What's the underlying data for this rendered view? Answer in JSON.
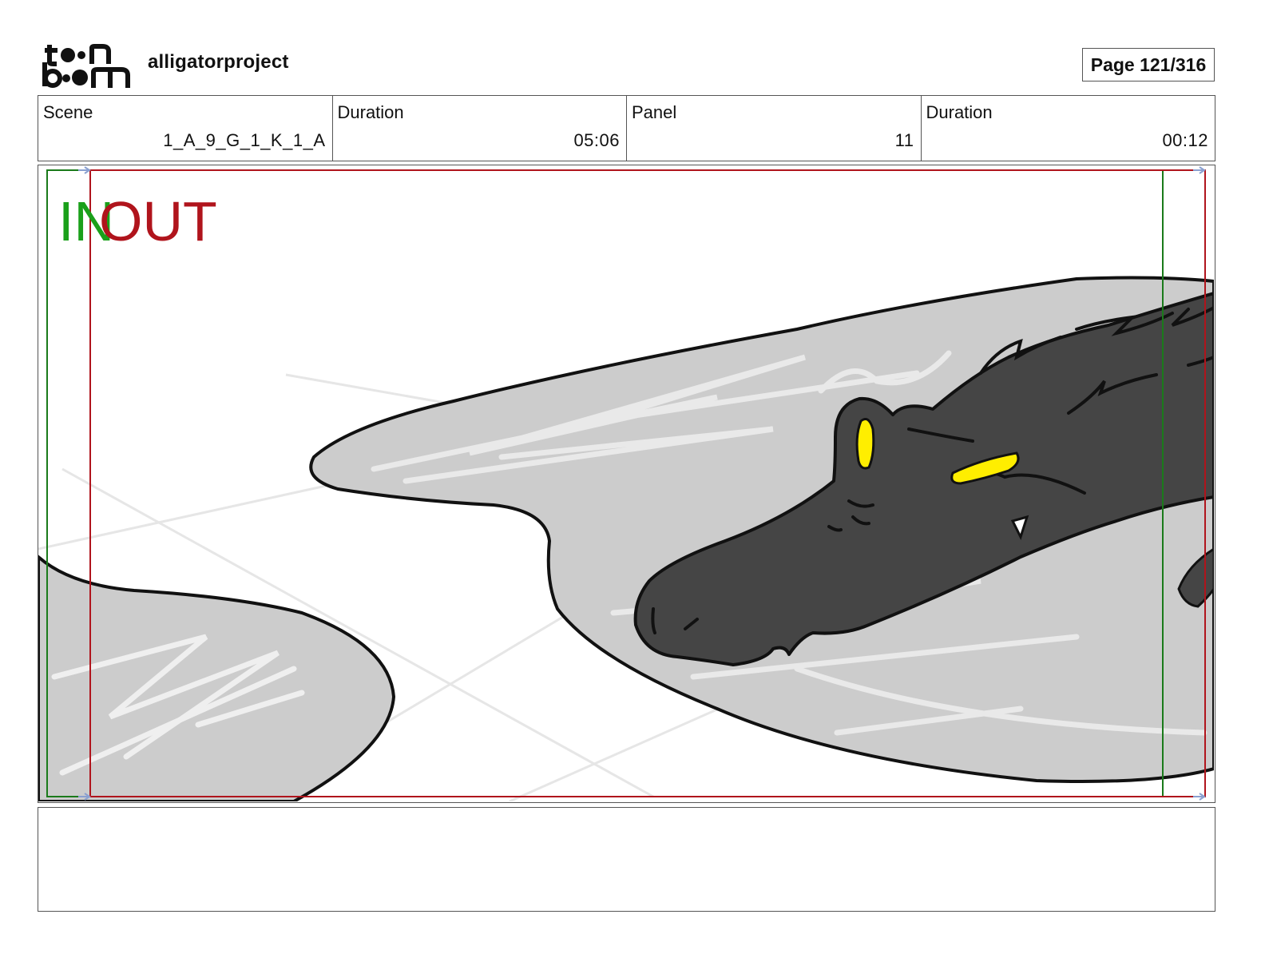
{
  "header": {
    "project_name": "alligatorproject",
    "page_label": "Page 121/316"
  },
  "scene_info": {
    "scene_label": "Scene",
    "scene_value": "1_A_9_G_1_K_1_A",
    "scene_duration_label": "Duration",
    "scene_duration_value": "05:06",
    "panel_label": "Panel",
    "panel_value": "11",
    "panel_duration_label": "Duration",
    "panel_duration_value": "00:12"
  },
  "panel": {
    "in_marker": "IN",
    "out_marker": "OUT",
    "colors": {
      "in": "#1aa01a",
      "out": "#b0141c",
      "water": "#cccccc",
      "alligator": "#454545",
      "eyes": "#ffee00"
    }
  },
  "notes": {
    "text": ""
  }
}
